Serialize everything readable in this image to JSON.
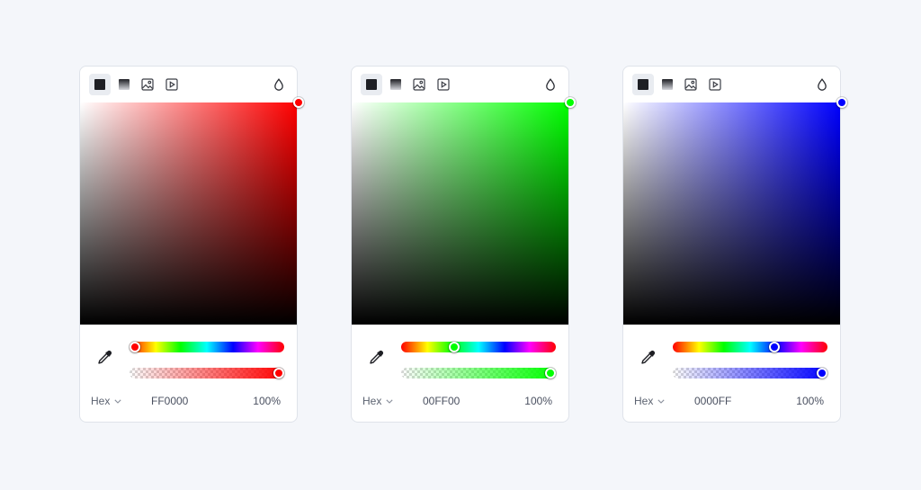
{
  "pickers": [
    {
      "hue_color": "#ff0000",
      "hue_position": 0.0,
      "alpha_position": 1.0,
      "format_label": "Hex",
      "hex_value": "FF0000",
      "alpha_label": "100%",
      "tools": [
        "solid-fill-icon",
        "gradient-fill-icon",
        "image-fill-icon",
        "video-fill-icon"
      ],
      "opacity_icon": "droplet-icon",
      "eyedropper_icon": "eyedropper-icon"
    },
    {
      "hue_color": "#00ff00",
      "hue_position": 0.333,
      "alpha_position": 1.0,
      "format_label": "Hex",
      "hex_value": "00FF00",
      "alpha_label": "100%",
      "tools": [
        "solid-fill-icon",
        "gradient-fill-icon",
        "image-fill-icon",
        "video-fill-icon"
      ],
      "opacity_icon": "droplet-icon",
      "eyedropper_icon": "eyedropper-icon"
    },
    {
      "hue_color": "#0000ff",
      "hue_position": 0.667,
      "alpha_position": 1.0,
      "format_label": "Hex",
      "hex_value": "0000FF",
      "alpha_label": "100%",
      "tools": [
        "solid-fill-icon",
        "gradient-fill-icon",
        "image-fill-icon",
        "video-fill-icon"
      ],
      "opacity_icon": "droplet-icon",
      "eyedropper_icon": "eyedropper-icon"
    }
  ]
}
